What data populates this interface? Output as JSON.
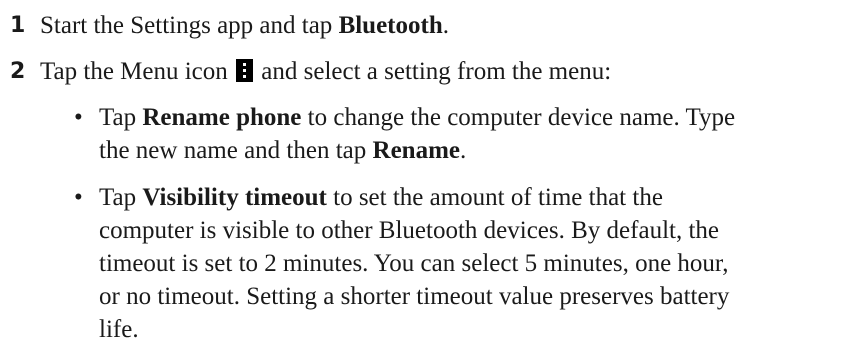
{
  "steps": [
    {
      "number": "1",
      "pre": "Start the Settings app and tap ",
      "bold": "Bluetooth",
      "post": "."
    },
    {
      "number": "2",
      "pre": "Tap the Menu icon ",
      "icon": "menu-icon",
      "post": " and select a setting from the menu:"
    }
  ],
  "bullets": [
    {
      "symbol": "•",
      "line1_pre": "Tap ",
      "line1_bold": "Rename phone",
      "line1_post": " to change the computer device name. Type",
      "line2_pre": "the new name and then tap ",
      "line2_bold": "Rename",
      "line2_post": "."
    },
    {
      "symbol": "•",
      "line1_pre": "Tap ",
      "line1_bold": "Visibility timeout",
      "line1_post": " to set the amount of time that the",
      "line2": "computer is visible to other Bluetooth devices. By default, the",
      "line3": "timeout is set to 2 minutes. You can select 5 minutes, one hour,",
      "line4": "or no timeout. Setting a shorter timeout value preserves battery",
      "line5": "life."
    }
  ]
}
